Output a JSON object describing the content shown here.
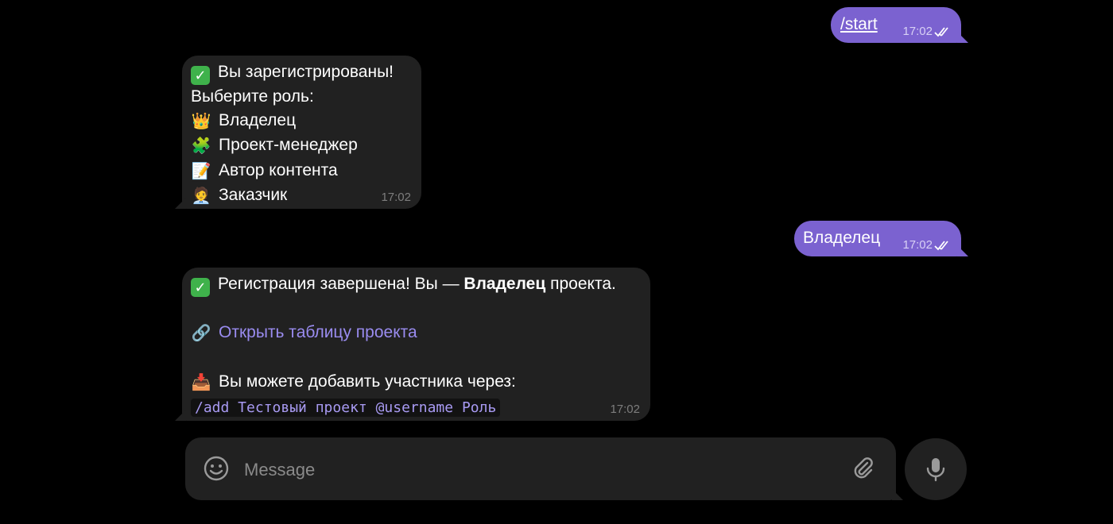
{
  "messages": {
    "start": {
      "text": "/start",
      "time": "17:02"
    },
    "registered": {
      "line1": "Вы зарегистрированы!",
      "line2": "Выберите роль:",
      "roles": [
        "Владелец",
        "Проект-менеджер",
        "Автор контента",
        "Заказчик"
      ],
      "time": "17:02"
    },
    "owner_reply": {
      "text": "Владелец",
      "time": "17:02"
    },
    "complete": {
      "text_before": "Регистрация завершена! Вы — ",
      "text_bold": "Владелец",
      "text_after": " проекта.",
      "link": "Открыть таблицу проекта",
      "add_hint": "Вы можете добавить участника через:",
      "command": "/add Тестовый проект @username Роль",
      "time": "17:02"
    }
  },
  "composer": {
    "placeholder": "Message"
  },
  "icons": {
    "check": "check-mark-button-emoji",
    "crown": "crown-emoji",
    "puzzle": "puzzle-piece-emoji",
    "memo": "memo-emoji",
    "person": "office-worker-emoji",
    "link": "link-emoji",
    "inbox": "inbox-tray-emoji",
    "smile": "smile-icon",
    "attach": "paperclip-icon",
    "mic": "microphone-icon"
  },
  "colors": {
    "outgoing": "#7B62D0",
    "incoming": "#212121",
    "link": "#9A8CF0",
    "background": "#000000"
  }
}
